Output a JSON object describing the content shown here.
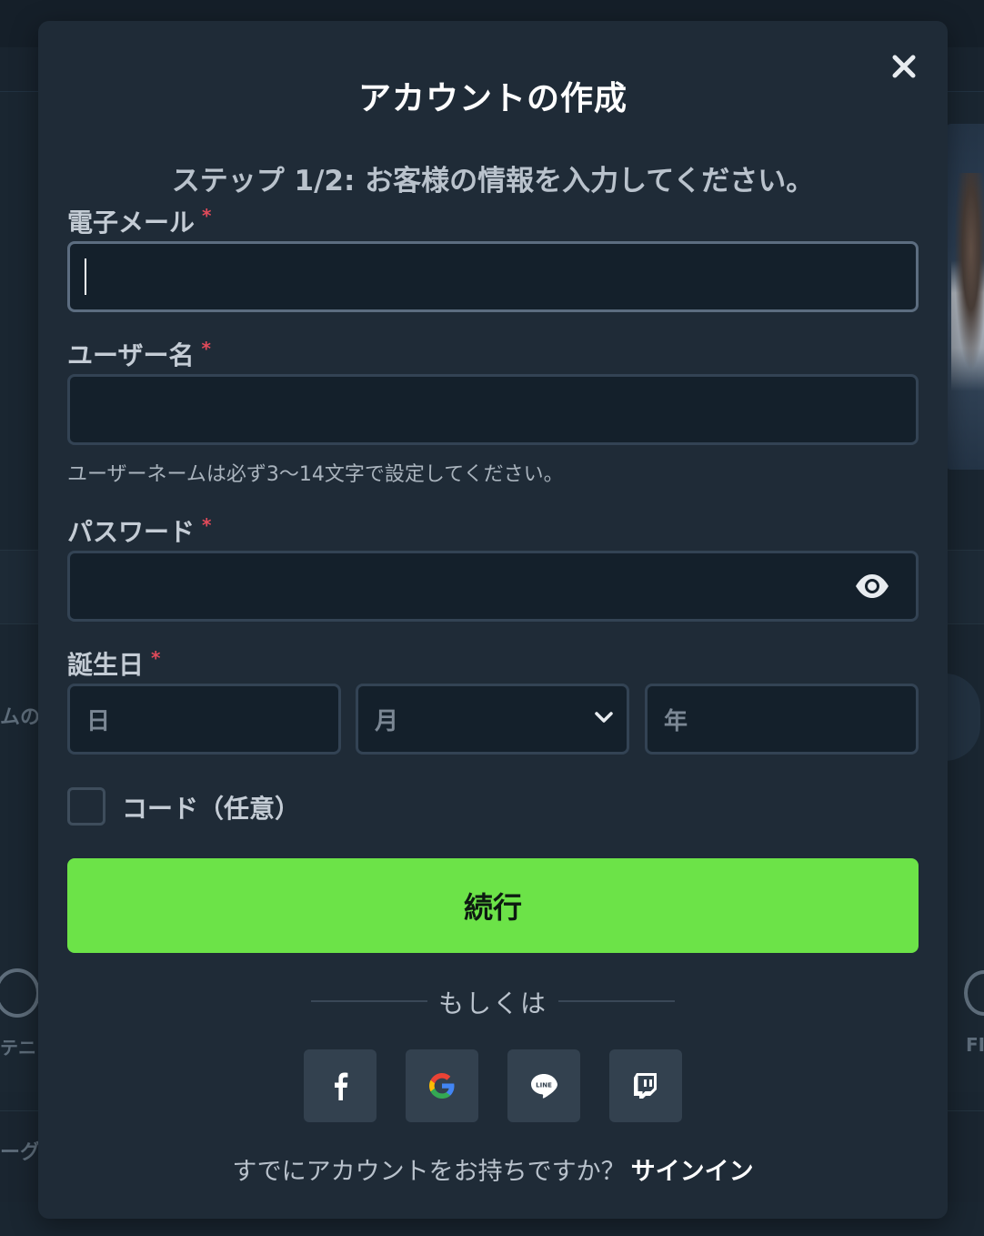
{
  "modal": {
    "title": "アカウントの作成",
    "step_text": "ステップ 1/2: お客様の情報を入力してください。",
    "close_icon": "close-icon"
  },
  "form": {
    "email": {
      "label": "電子メール",
      "required_mark": "*",
      "value": ""
    },
    "username": {
      "label": "ユーザー名",
      "required_mark": "*",
      "value": "",
      "hint": "ユーザーネームは必ず3〜14文字で設定してください。"
    },
    "password": {
      "label": "パスワード",
      "required_mark": "*",
      "value": "",
      "toggle_icon": "eye-icon"
    },
    "birthday": {
      "label": "誕生日",
      "required_mark": "*",
      "day_placeholder": "日",
      "month_placeholder": "月",
      "year_placeholder": "年"
    },
    "code": {
      "label": "コード（任意）",
      "checked": false
    },
    "continue_label": "続行"
  },
  "social": {
    "or_text": "もしくは",
    "buttons": [
      {
        "icon": "facebook-icon"
      },
      {
        "icon": "google-icon"
      },
      {
        "icon": "line-icon",
        "text": "LINE"
      },
      {
        "icon": "twitch-icon"
      }
    ]
  },
  "footer": {
    "question": "すでにアカウントをお持ちですか？",
    "signin_label": "サインイン"
  },
  "background": {
    "left_text_1": "ムの",
    "left_text_2": "テニ",
    "left_text_3": "ーグ",
    "right_text": "FI"
  },
  "colors": {
    "accent": "#6ce348",
    "modal_bg": "#1f2b37",
    "input_bg": "#14202b",
    "required": "#e04a5a"
  }
}
